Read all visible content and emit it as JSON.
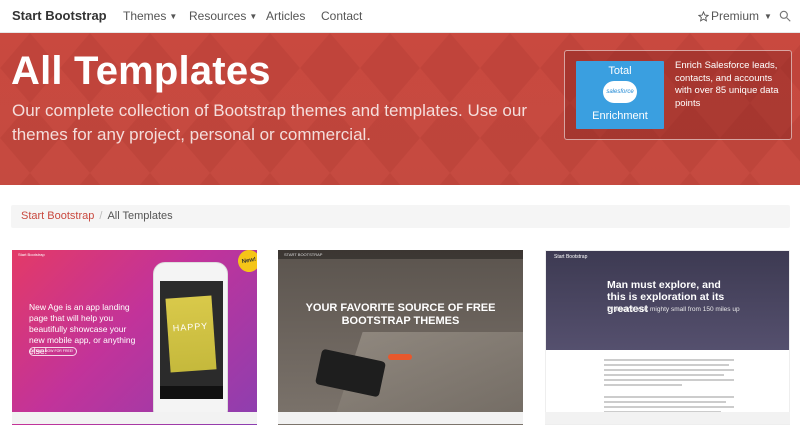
{
  "navbar": {
    "brand": "Start Bootstrap",
    "items": [
      {
        "label": "Themes",
        "has_caret": true
      },
      {
        "label": "Resources",
        "has_caret": true
      },
      {
        "label": "Articles",
        "has_caret": false
      },
      {
        "label": "Contact",
        "has_caret": false
      }
    ],
    "premium_label": "Premium",
    "premium_icon": "star-outline-icon",
    "search_icon": "search-icon"
  },
  "hero": {
    "title": "All Templates",
    "subtitle": "Our complete collection of Bootstrap themes and templates. Use our themes for any project, personal or commercial.",
    "background_color": "#c9493f"
  },
  "ad": {
    "image_top_text": "Total",
    "image_logo_text": "salesforce",
    "image_bottom_text": "Enrichment",
    "text": "Enrich Salesforce leads, contacts, and accounts with over 85 unique data points"
  },
  "breadcrumb": {
    "items": [
      "Start Bootstrap",
      "All Templates"
    ],
    "separator": "/"
  },
  "cards": [
    {
      "nav_brand": "Start Bootstrap",
      "text": "New Age is an app landing page that will help you beautifully showcase your new mobile app, or anything else!",
      "button": "START NOW FOR FREE!",
      "phone_text": "HAPPY",
      "badge": "New!"
    },
    {
      "nav_brand": "START BOOTSTRAP",
      "heading": "YOUR FAVORITE SOURCE OF FREE BOOTSTRAP THEMES"
    },
    {
      "nav_brand": "Start Bootstrap",
      "heading": "Man must explore, and this is exploration at its greatest",
      "subheading": "Problems look mighty small from 150 miles up"
    }
  ]
}
